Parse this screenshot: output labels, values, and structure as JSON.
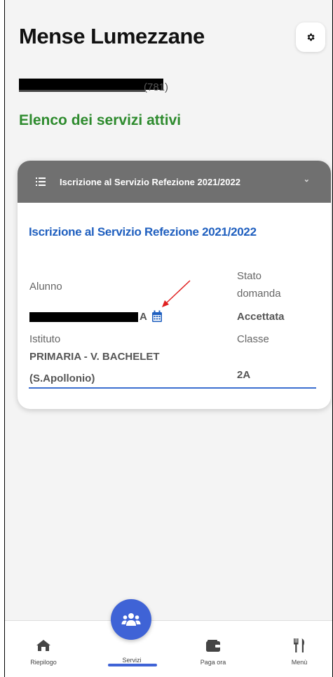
{
  "header": {
    "title": "Mense Lumezzane",
    "settings_icon": "gear-icon",
    "user_suffix": "(781)"
  },
  "section_title": "Elenco dei servizi attivi",
  "card": {
    "header_label": "Iscrizione al Servizio Refezione 2021/2022",
    "title": "Iscrizione al Servizio Refezione 2021/2022",
    "alunno_label": "Alunno",
    "alunno_suffix": "A",
    "stato_label_1": "Stato",
    "stato_label_2": "domanda",
    "stato_value": "Accettata",
    "istituto_label": "Istituto",
    "istituto_value_1": "PRIMARIA - V. BACHELET",
    "istituto_value_2": "(S.Apollonio)",
    "classe_label": "Classe",
    "classe_value": "2A"
  },
  "nav": {
    "items": [
      {
        "label": "Riepilogo",
        "icon": "home-icon"
      },
      {
        "label": "Servizi",
        "icon": "users-icon"
      },
      {
        "label": "Paga ora",
        "icon": "wallet-icon"
      },
      {
        "label": "Menù",
        "icon": "utensils-icon"
      }
    ]
  },
  "colors": {
    "accent": "#3f63d6",
    "section_green": "#2e8b2e",
    "card_title_blue": "#1f5fbf",
    "header_grey": "#707070"
  }
}
